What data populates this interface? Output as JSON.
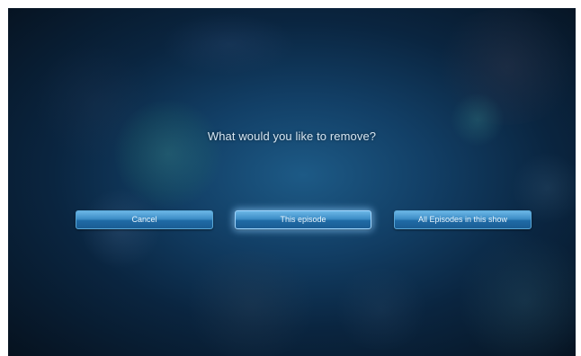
{
  "dialog": {
    "prompt": "What would you like to remove?",
    "buttons": {
      "cancel": "Cancel",
      "this_episode": "This episode",
      "all_episodes": "All Episodes in this show"
    },
    "focused_button": "this_episode"
  },
  "colors": {
    "background": "#0a2540",
    "button_top": "#6bb6e6",
    "button_bottom": "#1a5d94",
    "focus_glow": "#8ccdff",
    "text": "#d6e6f2"
  }
}
